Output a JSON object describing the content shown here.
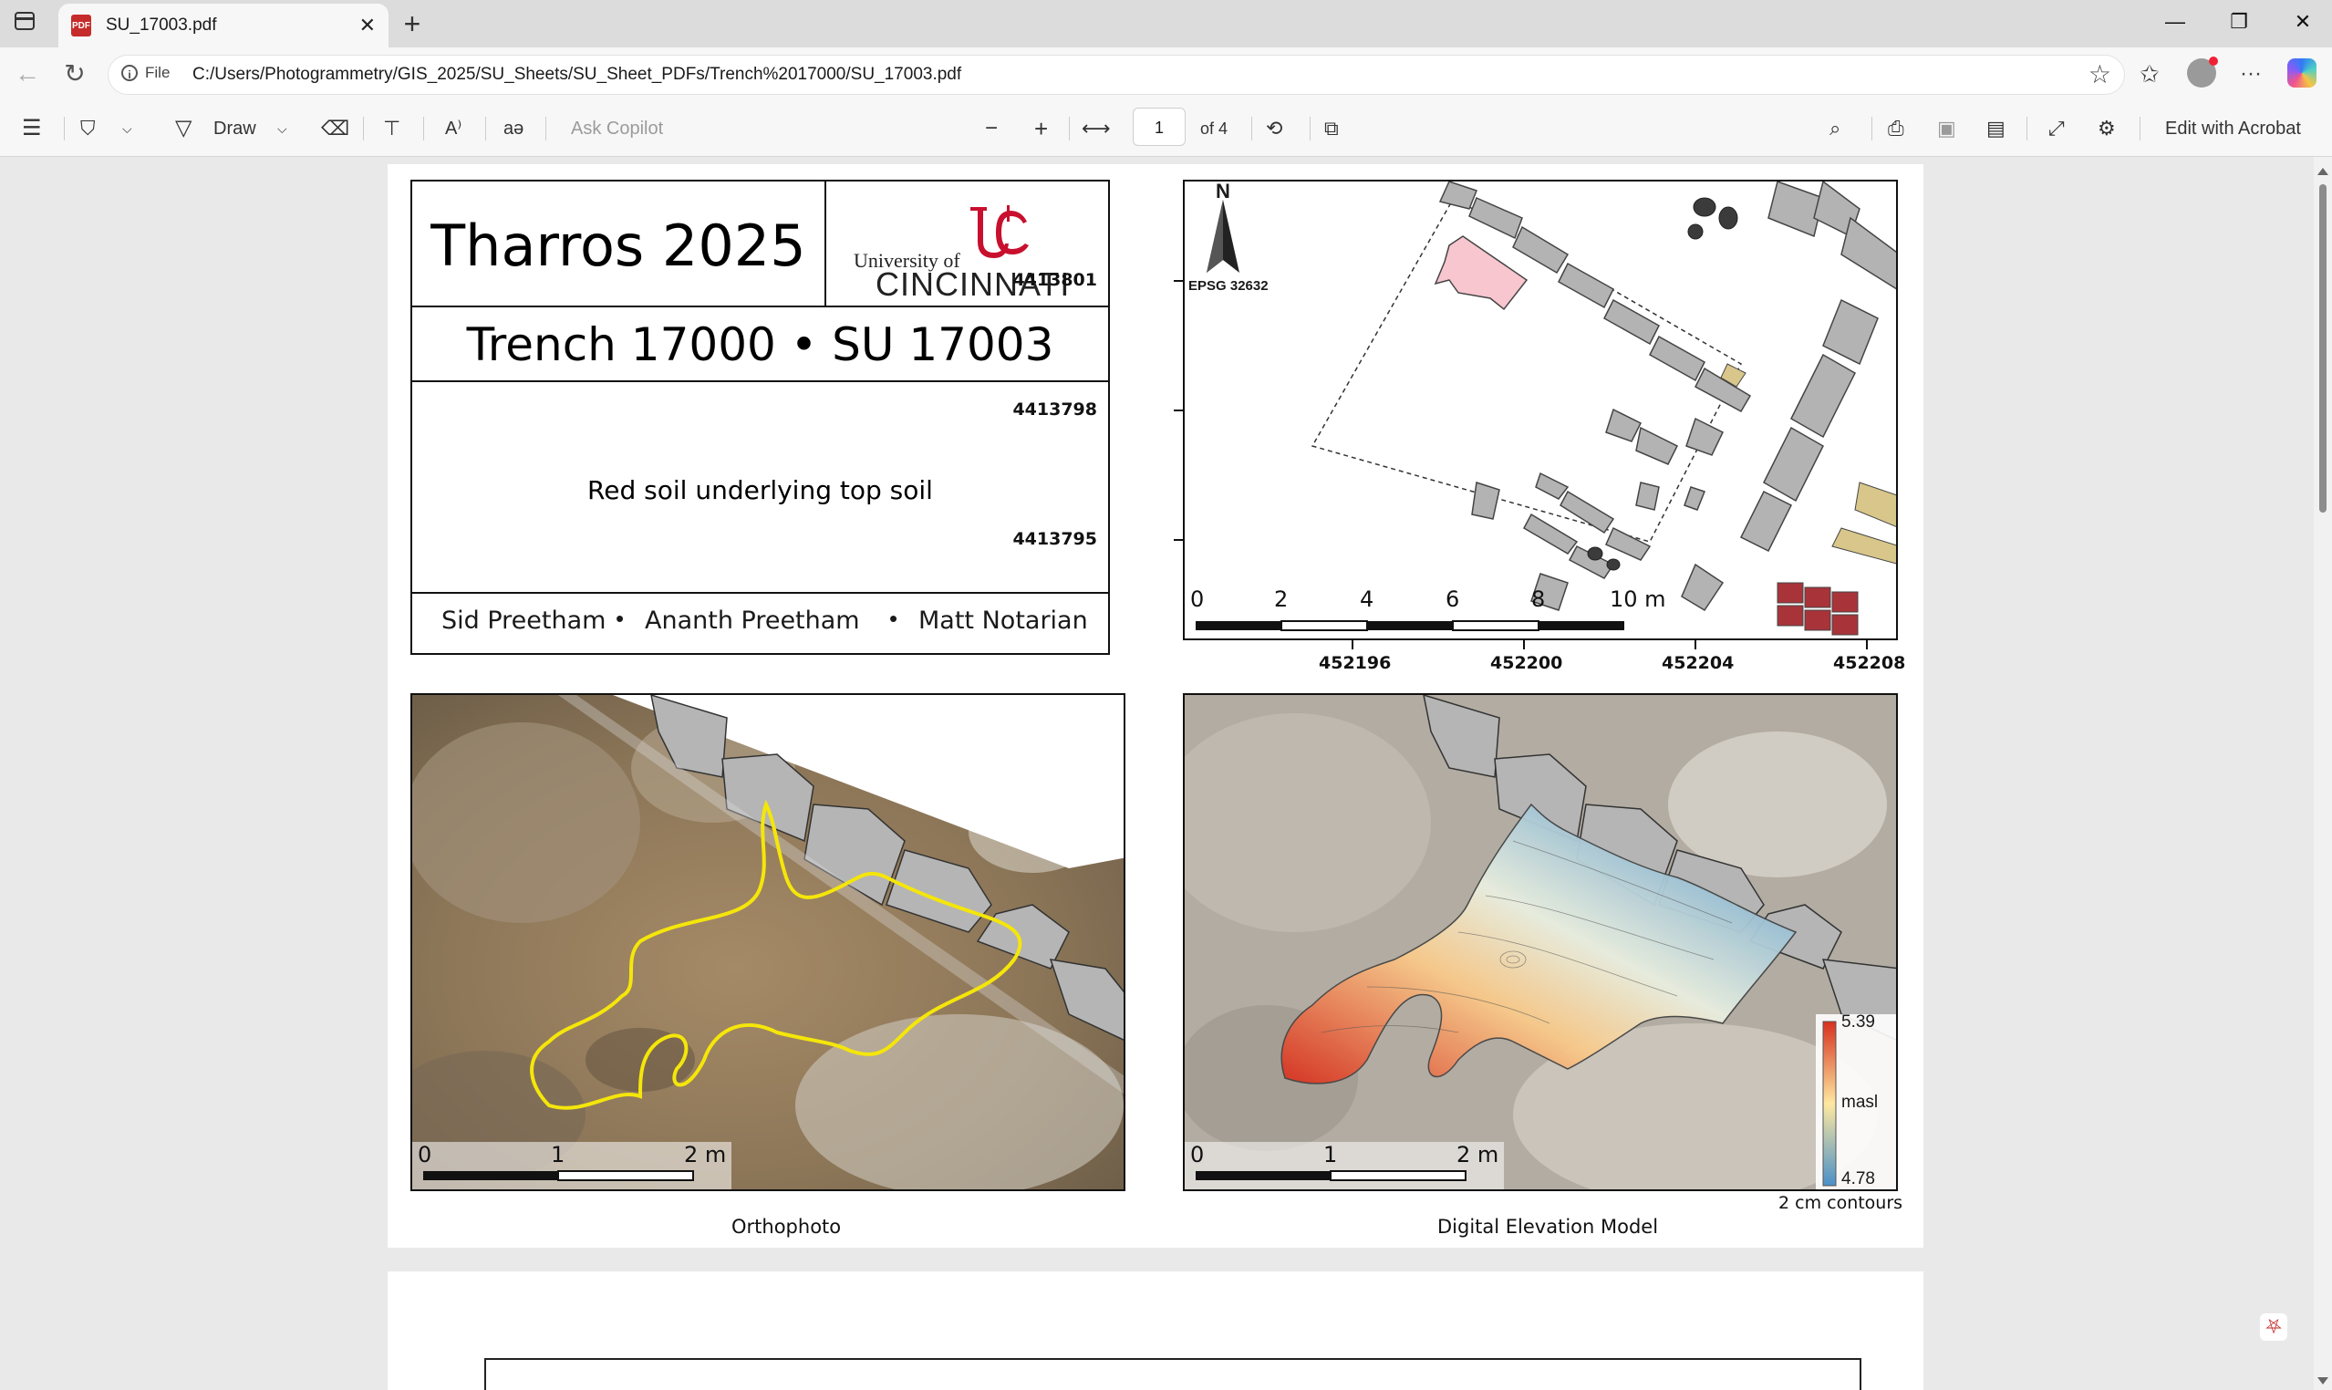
{
  "browser": {
    "tab_title": "SU_17003.pdf",
    "tab_icon": "pdf-icon",
    "new_tab": "+",
    "window_controls": [
      "—",
      "❐",
      "✕"
    ],
    "address": {
      "chip_label": "File",
      "url": "C:/Users/Photogrammetry/GIS_2025/SU_Sheets/SU_Sheet_PDFs/Trench%2017000/SU_17003.pdf"
    }
  },
  "pdf_toolbar": {
    "draw_label": "Draw",
    "ask_copilot": "Ask Copilot",
    "page_current": "1",
    "page_total": "of 4",
    "edit_acrobat": "Edit with Acrobat"
  },
  "sheet": {
    "project": "Tharros 2025",
    "university_small": "University of",
    "university_big": "CINCINNATI",
    "trench_su": "Trench 17000 • SU 17003",
    "description": "Red soil underlying top soil",
    "authors": [
      "Sid Preetham",
      "Ananth Preetham",
      "Matt Notarian"
    ],
    "bullet": "•"
  },
  "site_map": {
    "north": "N",
    "epsg": "EPSG 32632",
    "y_coords": [
      "4413801",
      "4413798",
      "4413795"
    ],
    "x_coords": [
      "452196",
      "452200",
      "452204",
      "452208"
    ],
    "scale_labels": [
      "0",
      "2",
      "4",
      "6",
      "8",
      "10 m"
    ]
  },
  "ortho": {
    "caption": "Orthophoto",
    "scale_labels": [
      "0",
      "1",
      "2 m"
    ]
  },
  "dem": {
    "caption": "Digital Elevation Model",
    "scale_labels": [
      "0",
      "1",
      "2 m"
    ],
    "legend_max": "5.39",
    "legend_unit": "masl",
    "legend_min": "4.78",
    "contours_note": "2 cm contours",
    "colors": {
      "high": "#d7301f",
      "mid": "#fee8a0",
      "low": "#4a90c8"
    }
  }
}
